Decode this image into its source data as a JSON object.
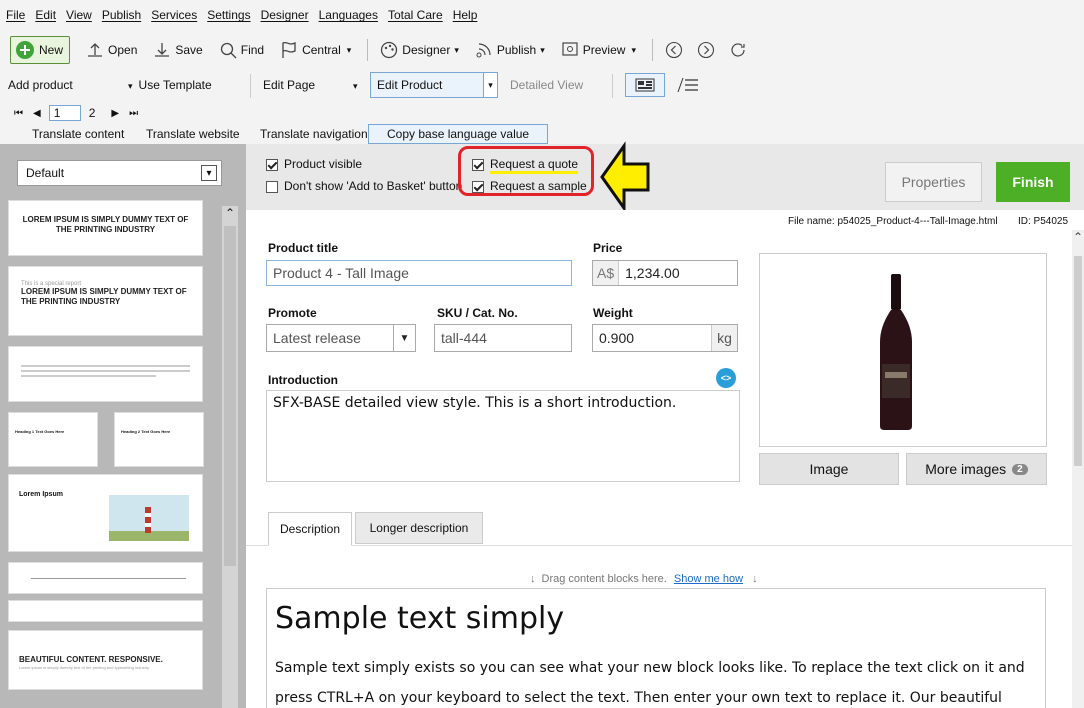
{
  "menu": [
    "File",
    "Edit",
    "View",
    "Publish",
    "Services",
    "Settings",
    "Designer",
    "Languages",
    "Total Care",
    "Help"
  ],
  "toolbar": {
    "new": "New",
    "open": "Open",
    "save": "Save",
    "find": "Find",
    "central": "Central",
    "designer": "Designer",
    "publish": "Publish",
    "preview": "Preview"
  },
  "row3": {
    "add_product": "Add product",
    "use_template": "Use Template",
    "edit_page": "Edit Page",
    "edit_product": "Edit Product",
    "detailed_view": "Detailed View"
  },
  "pager": {
    "page1": "1",
    "page2": "2"
  },
  "row5": {
    "translate_content": "Translate content",
    "translate_website": "Translate website",
    "translate_navigation": "Translate navigation",
    "copy_base": "Copy base language value"
  },
  "left": {
    "style_select": "Default",
    "thumb1": "LOREM IPSUM IS SIMPLY DUMMY TEXT OF THE PRINTING INDUSTRY",
    "thumb2_small": "This is a special report",
    "thumb2": "LOREM IPSUM IS SIMPLY DUMMY TEXT OF THE PRINTING INDUSTRY",
    "thumb4a": "Heading 1 Text Goes Here",
    "thumb4b": "Heading 2 Text Goes Here",
    "thumb5": "Lorem Ipsum",
    "thumb8": "BEAUTIFUL CONTENT. RESPONSIVE.",
    "thumb8_small": "Lorem ipsum is simply dummy text of the printing and typesetting industry."
  },
  "options": {
    "product_visible": "Product visible",
    "dont_show_basket": "Don't show 'Add to Basket' button",
    "request_quote": "Request a quote",
    "request_sample": "Request a sample"
  },
  "head_buttons": {
    "properties": "Properties",
    "finish": "Finish"
  },
  "file_info": {
    "file_name": "File name: p54025_Product-4---Tall-Image.html",
    "id": "ID: P54025"
  },
  "form": {
    "product_title_label": "Product title",
    "product_title": "Product 4 - Tall Image",
    "price_label": "Price",
    "currency": "A$",
    "price": "1,234.00",
    "promote_label": "Promote",
    "promote": "Latest release",
    "sku_label": "SKU / Cat. No.",
    "sku": "tall-444",
    "weight_label": "Weight",
    "weight": "0.900",
    "weight_unit": "kg",
    "intro_label": "Introduction",
    "intro": "SFX-BASE detailed view style. This is a short introduction."
  },
  "image_buttons": {
    "image": "Image",
    "more_images": "More images",
    "more_count": "2"
  },
  "tabs": {
    "description": "Description",
    "longer": "Longer description"
  },
  "content": {
    "drag_hint": "Drag content blocks here.",
    "show_me_how": "Show me how",
    "heading": "Sample text simply",
    "para": "Sample text simply exists so you can see what your new block looks like. To replace the text click on it and press CTRL+A on your keyboard to select the text. Then enter your own text to replace it. Our beautiful"
  },
  "colors": {
    "finish": "#4caf26",
    "highlight": "#e0242a",
    "arrow": "#ffee00",
    "link": "#1a6ec7"
  }
}
